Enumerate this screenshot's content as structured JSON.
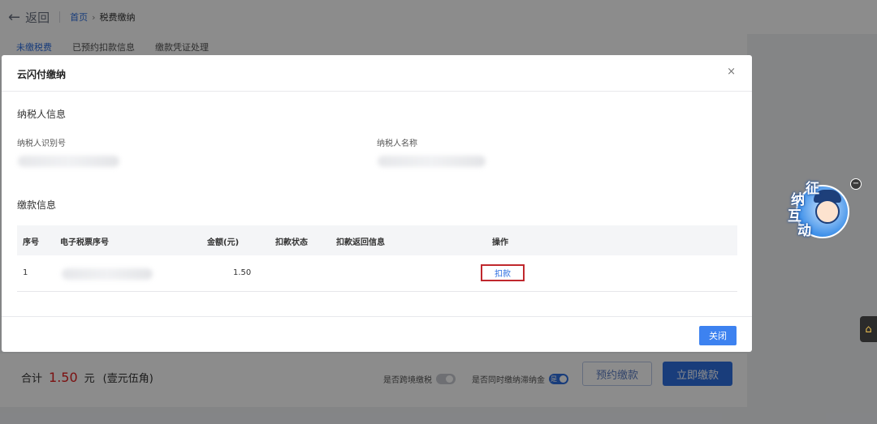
{
  "header": {
    "back_label": "返回",
    "breadcrumb": {
      "home": "首页",
      "separator": "›",
      "current": "税费缴纳"
    }
  },
  "tabs": [
    {
      "label": "未缴税费",
      "active": true
    },
    {
      "label": "已预约扣款信息",
      "active": false
    },
    {
      "label": "缴款凭证处理",
      "active": false
    }
  ],
  "footer": {
    "total_label": "合计",
    "total_amount": "1.50",
    "unit": "元",
    "amount_in_words": "(壹元伍角)",
    "cross_border_label": "是否跨境缴税",
    "cross_border_on": false,
    "pay_together_label": "是否同时缴纳滞纳金",
    "pay_together_toggle_text": "是",
    "pay_together_on": true,
    "reserve_button": "预约缴款",
    "pay_now_button": "立即缴款"
  },
  "widget": {
    "chars": [
      "征",
      "纳",
      "互",
      "动"
    ],
    "minimize_symbol": "−"
  },
  "modal": {
    "title": "云闪付缴纳",
    "close_symbol": "×",
    "taxpayer_section": "纳税人信息",
    "taxpayer_id_label": "纳税人识别号",
    "taxpayer_name_label": "纳税人名称",
    "payment_section": "缴款信息",
    "table": {
      "headers": [
        "序号",
        "电子税票序号",
        "金额(元)",
        "扣款状态",
        "扣款返回信息",
        "操作"
      ],
      "rows": [
        {
          "index": "1",
          "ticket_no": "",
          "amount": "1.50",
          "status": "",
          "return_info": "",
          "action": "扣款"
        }
      ]
    },
    "close_button": "关闭"
  },
  "colors": {
    "accent": "#2f6fe0",
    "amount_red": "#e02020",
    "highlight_border": "#c0282d"
  }
}
